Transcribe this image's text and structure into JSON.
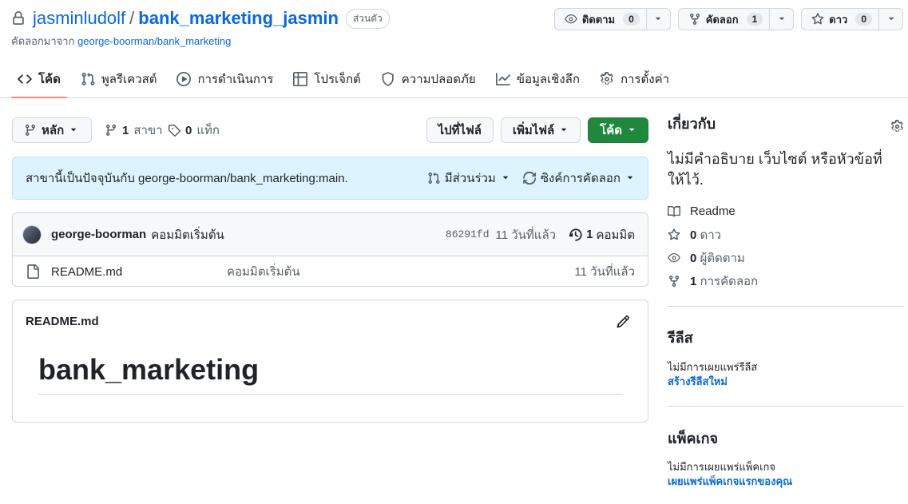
{
  "repo": {
    "owner": "jasminludolf",
    "slash": "/",
    "name": "bank_marketing_jasmin",
    "visibility": "ส่วนตัว",
    "forked_prefix": "คัดลอกมาจาก",
    "forked_source": "george-boorman/bank_marketing"
  },
  "actions": {
    "watch": {
      "label": "ติดตาม",
      "count": "0",
      "icon": "eye-icon"
    },
    "fork": {
      "label": "คัดลอก",
      "count": "1",
      "icon": "fork-icon"
    },
    "star": {
      "label": "ดาว",
      "count": "0",
      "icon": "star-icon"
    }
  },
  "tabs": [
    {
      "label": "โค้ด",
      "icon": "code-icon",
      "active": true
    },
    {
      "label": "พูลรีเควสต์",
      "icon": "pull-request-icon"
    },
    {
      "label": "การดำเนินการ",
      "icon": "play-icon"
    },
    {
      "label": "โปรเจ็กต์",
      "icon": "table-icon"
    },
    {
      "label": "ความปลอดภัย",
      "icon": "shield-icon"
    },
    {
      "label": "ข้อมูลเชิงลึก",
      "icon": "graph-icon"
    },
    {
      "label": "การตั้งค่า",
      "icon": "gear-icon"
    }
  ],
  "file_nav": {
    "branch": "หลัก",
    "branches_count": "1",
    "branches_label": "สาขา",
    "tags_count": "0",
    "tags_label": "แท็ก",
    "go_to_file": "ไปที่ไฟล์",
    "add_file": "เพิ่มไฟล์",
    "code": "โค้ด"
  },
  "sync": {
    "message": "สาขานี้เป็นปัจจุบันกับ george-boorman/bank_marketing:main.",
    "contribute": "มีส่วนร่วม",
    "sync_fork": "ซิงค์การคัดลอก"
  },
  "commit": {
    "author": "george-boorman",
    "message": "คอมมิตเริ่มต้น",
    "sha": "86291fd",
    "ago": "11 วันที่แล้ว",
    "count": "1",
    "count_label": "คอมมิต"
  },
  "files": [
    {
      "name": "README.md",
      "message": "คอมมิตเริ่มต้น",
      "ago": "11 วันที่แล้ว"
    }
  ],
  "readme": {
    "filename": "README.md",
    "heading": "bank_marketing"
  },
  "sidebar": {
    "about_title": "เกี่ยวกับ",
    "about_desc": "ไม่มีคำอธิบาย เว็บไซต์ หรือหัวข้อที่ให้ไว้.",
    "readme": "Readme",
    "stars_count": "0",
    "stars_label": "ดาว",
    "watchers_count": "0",
    "watchers_label": "ผู้ติดตาม",
    "forks_count": "1",
    "forks_label": "การคัดลอก",
    "releases_title": "รีลีส",
    "releases_text": "ไม่มีการเผยแพร่รีลีส",
    "releases_link": "สร้างรีลีสใหม่",
    "packages_title": "แพ็คเกจ",
    "packages_text": "ไม่มีการเผยแพร่แพ็คเกจ",
    "packages_link": "เผยแพร่แพ็คเกจแรกของคุณ"
  },
  "colors": {
    "link": "#0969da",
    "primary_button": "#1f883d",
    "active_tab_underline": "#fd8c73",
    "sync_banner_bg": "#ddf4ff"
  }
}
